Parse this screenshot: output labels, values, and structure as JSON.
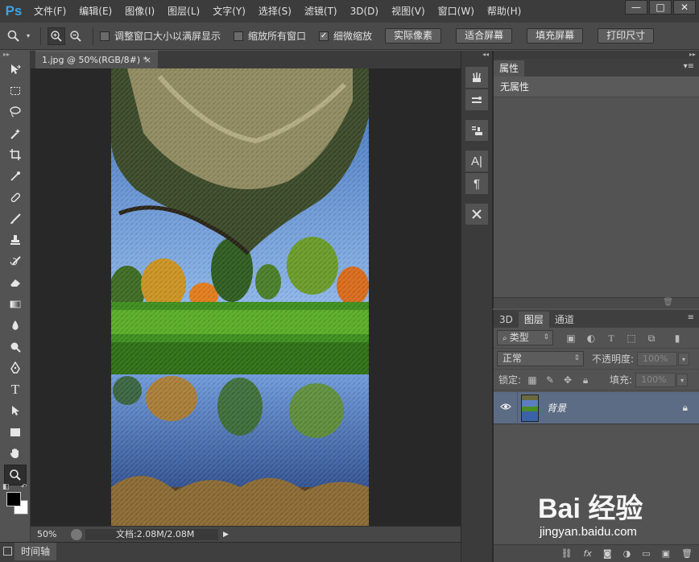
{
  "app": {
    "logo": "Ps",
    "menu": [
      "文件(F)",
      "编辑(E)",
      "图像(I)",
      "图层(L)",
      "文字(Y)",
      "选择(S)",
      "滤镜(T)",
      "3D(D)",
      "视图(V)",
      "窗口(W)",
      "帮助(H)"
    ],
    "window_controls": [
      "—",
      "□",
      "✕"
    ]
  },
  "options_bar": {
    "checkboxes": [
      {
        "label": "调整窗口大小以满屏显示",
        "checked": false
      },
      {
        "label": "缩放所有窗口",
        "checked": false
      },
      {
        "label": "细微缩放",
        "checked": true
      }
    ],
    "buttons": [
      "实际像素",
      "适合屏幕",
      "填充屏幕",
      "打印尺寸"
    ]
  },
  "document": {
    "tab_title": "1.jpg @ 50%(RGB/8#) *",
    "zoom": "50%",
    "doc_info": "文档:2.08M/2.08M"
  },
  "timeline": {
    "tab": "时间轴"
  },
  "properties": {
    "tab": "属性",
    "content": "无属性"
  },
  "layers": {
    "tabs": [
      "3D",
      "图层",
      "通道"
    ],
    "active_tab": "图层",
    "filter_kind": "类型",
    "blend_mode": "正常",
    "opacity_label": "不透明度:",
    "opacity_value": "100%",
    "lock_label": "锁定:",
    "fill_label": "填充:",
    "fill_value": "100%",
    "items": [
      {
        "name": "背景",
        "visible": true,
        "locked": true
      }
    ],
    "bottom_icons": [
      "link-icon",
      "fx-icon",
      "mask-icon",
      "adjustment-icon",
      "group-icon",
      "new-layer-icon",
      "trash-icon"
    ]
  },
  "watermark": {
    "logo": "Bai 经验",
    "url": "jingyan.baidu.com"
  }
}
